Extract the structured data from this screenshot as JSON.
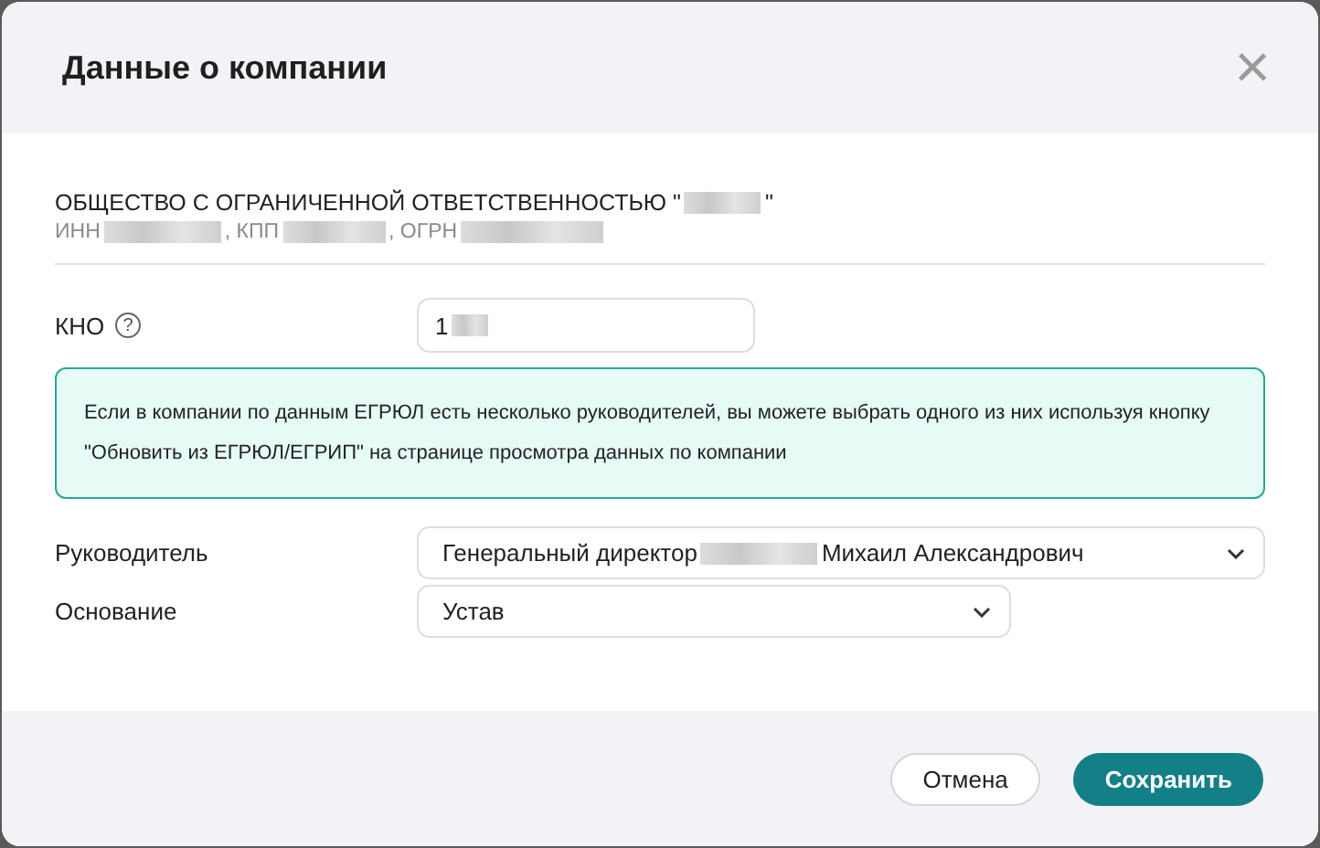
{
  "dialog": {
    "title": "Данные о компании",
    "close": "×"
  },
  "company": {
    "name_prefix": "ОБЩЕСТВО С ОГРАНИЧЕННОЙ ОТВЕТСТВЕННОСТЬЮ \"",
    "name_suffix": "\"",
    "ids": [
      {
        "label": "ИНН"
      },
      {
        "label": ", КПП"
      },
      {
        "label": ", ОГРН"
      }
    ]
  },
  "kno": {
    "label": "КНО",
    "help": "?",
    "value": "1"
  },
  "info": "Если в компании по данным ЕГРЮЛ есть несколько руководителей, вы можете выбрать одного из них используя кнопку \"Обновить из ЕГРЮЛ/ЕГРИП\" на странице просмотра данных по компании",
  "selects": [
    {
      "label": "Руководитель",
      "value_prefix": "Генеральный директор",
      "value_suffix": "Михаил Александрович",
      "wide": true
    },
    {
      "label": "Основание",
      "value_prefix": "Устав",
      "wide": false
    }
  ],
  "buttons": [
    {
      "label": "Отмена",
      "kind": "secondary"
    },
    {
      "label": "Сохранить",
      "kind": "primary"
    }
  ]
}
